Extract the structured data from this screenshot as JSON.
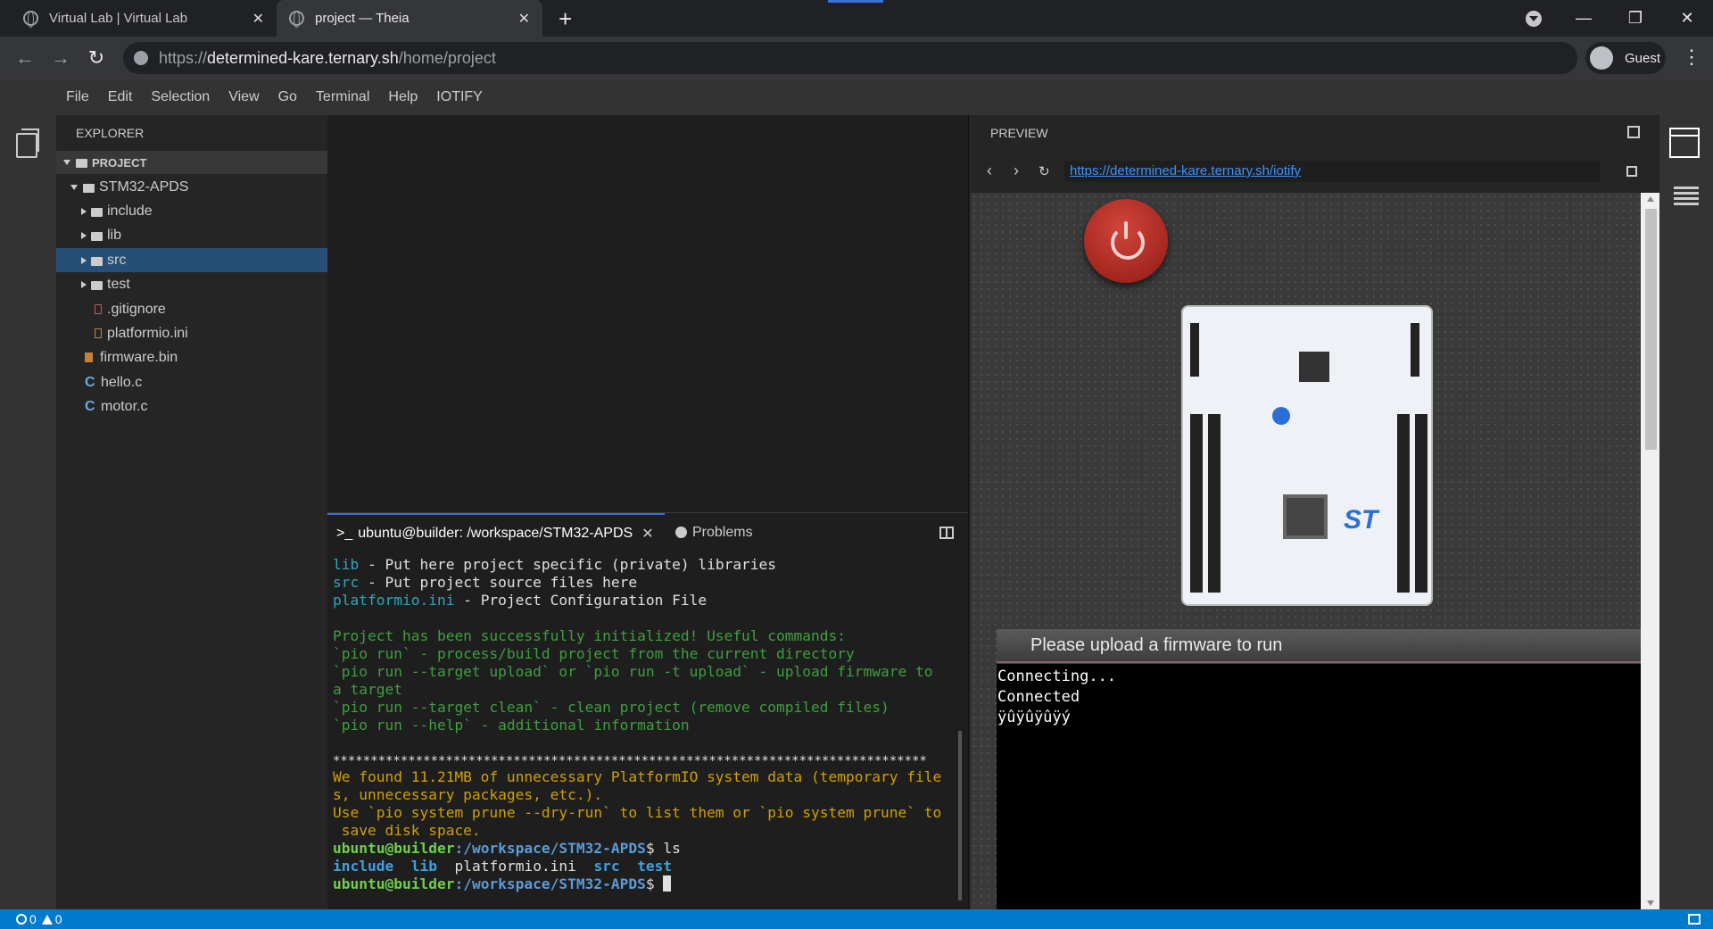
{
  "browser": {
    "tabs": [
      {
        "title": "Virtual Lab | Virtual Lab",
        "active": false
      },
      {
        "title": "project — Theia",
        "active": true
      }
    ],
    "url_scheme": "https://",
    "url_host": "determined-kare.ternary.sh",
    "url_path": "/home/project",
    "profile": "Guest",
    "icons": {
      "back": "←",
      "forward": "→",
      "reload": "↻",
      "new_tab": "+",
      "close": "✕",
      "menu": "⋮",
      "minimize": "—",
      "maximize": "❐",
      "win_close": "✕"
    }
  },
  "menu": [
    "File",
    "Edit",
    "Selection",
    "View",
    "Go",
    "Terminal",
    "Help",
    "IOTIFY"
  ],
  "explorer": {
    "title": "EXPLORER",
    "project": "PROJECT",
    "items": [
      {
        "label": "STM32-APDS",
        "type": "folder-open"
      },
      {
        "label": "include",
        "type": "folder"
      },
      {
        "label": "lib",
        "type": "folder"
      },
      {
        "label": "src",
        "type": "folder",
        "selected": true
      },
      {
        "label": "test",
        "type": "folder"
      },
      {
        "label": ".gitignore",
        "type": "file"
      },
      {
        "label": "platformio.ini",
        "type": "file"
      },
      {
        "label": "firmware.bin",
        "type": "bin"
      },
      {
        "label": "hello.c",
        "type": "c"
      },
      {
        "label": "motor.c",
        "type": "c"
      }
    ]
  },
  "panel": {
    "terminal_tab": "ubuntu@builder: /workspace/STM32-APDS",
    "problems_tab": "Problems",
    "prompt_user": "ubuntu@builder",
    "prompt_path": ":/workspace/STM32-APDS",
    "lines": [
      {
        "a": "lib",
        "b": " - Put here project specific (private) libraries"
      },
      {
        "a": "src",
        "b": " - Put project source files here"
      },
      {
        "a": "platformio.ini",
        "b": " - Project Configuration File"
      },
      {
        "g": ""
      },
      {
        "g": "Project has been successfully initialized! Useful commands:"
      },
      {
        "g": "`pio run` - process/build project from the current directory"
      },
      {
        "g": "`pio run --target upload` or `pio run -t upload` - upload firmware to"
      },
      {
        "g": "a target"
      },
      {
        "g": "`pio run --target clean` - clean project (remove compiled files)"
      },
      {
        "g": "`pio run --help` - additional information"
      }
    ],
    "stars": "*******************************************************************************",
    "warn": [
      "We found 11.21MB of unnecessary PlatformIO system data (temporary file",
      "s, unnecessary packages, etc.).",
      "Use `pio system prune --dry-run` to list them or `pio system prune` to",
      " save disk space."
    ],
    "cmd1": "$ ls",
    "ls_dirs": [
      "include",
      "lib"
    ],
    "ls_file": "platformio.ini",
    "ls_dirs2": [
      "src",
      "test"
    ],
    "cmd2": "$ "
  },
  "preview": {
    "title": "PREVIEW",
    "url": "https://determined-kare.ternary.sh/iotify",
    "firmware_msg": "Please upload a firmware to run",
    "serial": [
      "Connecting...",
      "Connected",
      "ÿûÿûÿûÿý"
    ]
  },
  "status": {
    "errors": "0",
    "warnings": "0"
  }
}
